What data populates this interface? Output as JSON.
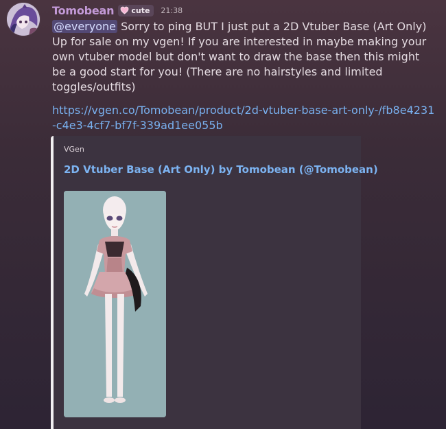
{
  "message": {
    "username": "Tomobean",
    "role_tag": "cute",
    "timestamp": "21:38",
    "mention": "@everyone",
    "text_after_mention": " Sorry to ping BUT I just put a 2D Vtuber Base (Art Only) Up for sale on my vgen! If you are interested in maybe making your own vtuber model but don't want to draw the base then this might be a good start for you! (There are no hairstyles and limited toggles/outfits)",
    "link": "https://vgen.co/Tomobean/product/2d-vtuber-base-art-only-/fb8e4231-c4e3-4cf7-bf7f-339ad1ee055b"
  },
  "embed": {
    "provider": "VGen",
    "title": "2D Vtuber Base (Art Only) by Tomobean (@Tomobean)"
  },
  "colors": {
    "username": "#c39ad8",
    "link": "#79b1f0",
    "embed_image_bg": "#93b0b4"
  }
}
